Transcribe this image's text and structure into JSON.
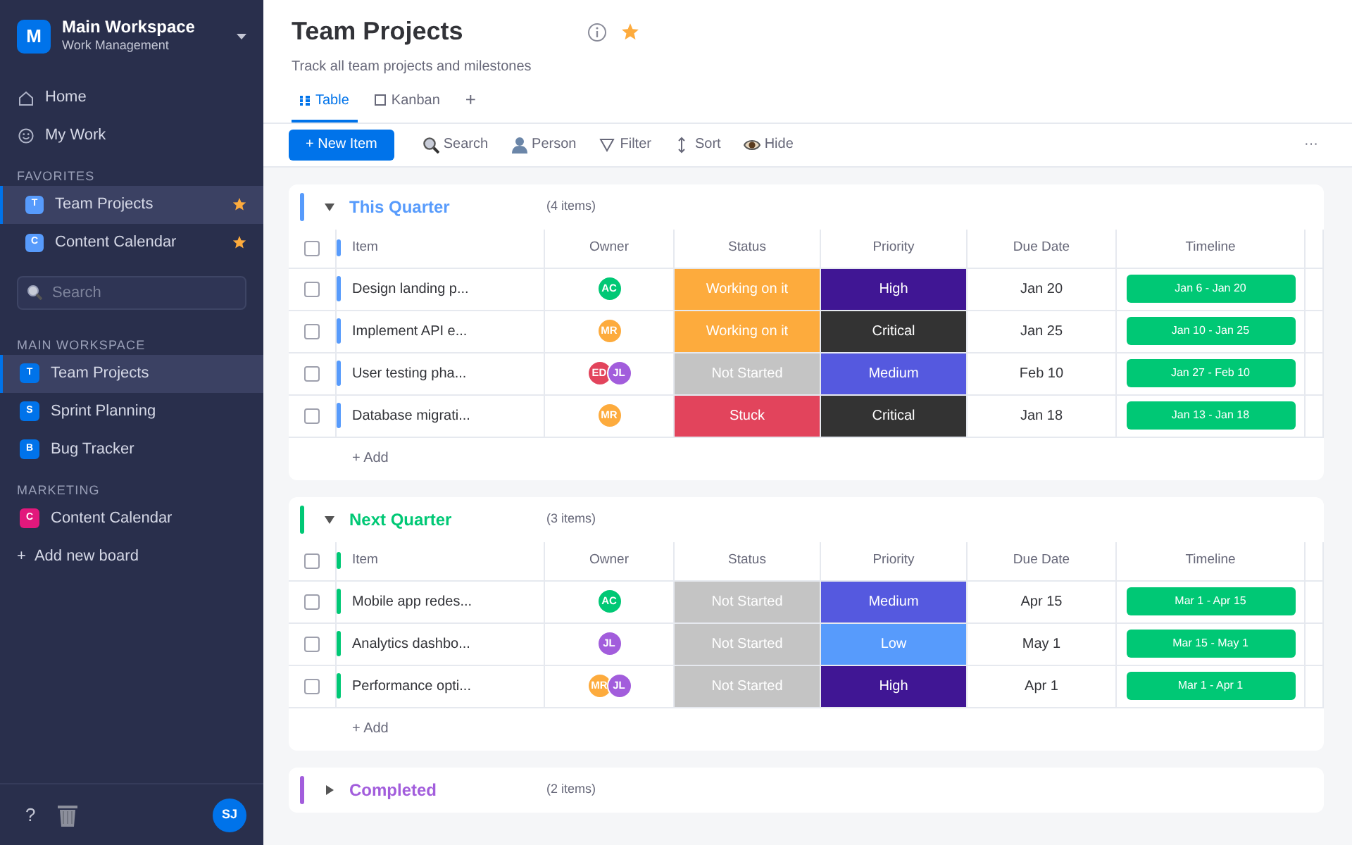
{
  "workspace": {
    "initial": "M",
    "name": "Main Workspace",
    "subtitle": "Work Management"
  },
  "nav": [
    {
      "kind": "home",
      "label": "Home"
    },
    {
      "kind": "mywork",
      "label": "My Work"
    }
  ],
  "favorites": {
    "label": "FAVORITES",
    "items": [
      {
        "initial": "T",
        "label": "Team Projects",
        "color": "#579bfc",
        "selected": true,
        "starred": true
      },
      {
        "initial": "C",
        "label": "Content Calendar",
        "color": "#579bfc",
        "selected": false,
        "starred": true
      }
    ]
  },
  "sidebar_search": {
    "placeholder": "Search"
  },
  "board_sections": [
    {
      "label": "MAIN WORKSPACE",
      "items": [
        {
          "initial": "T",
          "label": "Team Projects",
          "color": "#0073ea",
          "selected": true
        },
        {
          "initial": "S",
          "label": "Sprint Planning",
          "color": "#0073ea",
          "selected": false
        },
        {
          "initial": "B",
          "label": "Bug Tracker",
          "color": "#0073ea",
          "selected": false
        }
      ]
    },
    {
      "label": "MARKETING",
      "items": [
        {
          "initial": "C",
          "label": "Content Calendar",
          "color": "#e2187c",
          "selected": false
        }
      ]
    }
  ],
  "add_board": {
    "icon": "+",
    "label": "Add new board"
  },
  "sidebar_footer": {
    "help": "?",
    "avatar": "SJ"
  },
  "board": {
    "title": "Team Projects",
    "favorite": true,
    "subtitle": "Track all team projects and milestones"
  },
  "tabs": [
    {
      "kind": "table",
      "label": "Table",
      "selected": true
    },
    {
      "kind": "kanban",
      "label": "Kanban",
      "selected": false
    }
  ],
  "add_tab": "+",
  "toolbar": {
    "new_item": "+ New Item",
    "tools": [
      {
        "kind": "search",
        "label": "Search"
      },
      {
        "kind": "person",
        "label": "Person"
      },
      {
        "kind": "filter",
        "label": "Filter"
      },
      {
        "kind": "sort",
        "label": "Sort"
      },
      {
        "kind": "hide",
        "label": "Hide"
      }
    ],
    "more": "···"
  },
  "groups": [
    {
      "title": "This Quarter",
      "color": "#579bfc",
      "count": "(4 items)",
      "expanded": true,
      "all_checked": false,
      "columns": [
        "Item",
        "Owner",
        "Status",
        "Priority",
        "Due Date",
        "Timeline"
      ],
      "rows": [
        {
          "item": "Design landing p...",
          "checked": false,
          "owners": [
            {
              "initials": "AC",
              "color": "#00c875"
            }
          ],
          "status": {
            "label": "Working on it",
            "color": "#fdab3d"
          },
          "priority": {
            "label": "High",
            "color": "#401694"
          },
          "due": "Jan 20",
          "timeline": "Jan 6 - Jan 20"
        },
        {
          "item": "Implement API e...",
          "checked": false,
          "owners": [
            {
              "initials": "MR",
              "color": "#fdab3d"
            }
          ],
          "status": {
            "label": "Working on it",
            "color": "#fdab3d"
          },
          "priority": {
            "label": "Critical",
            "color": "#333333"
          },
          "due": "Jan 25",
          "timeline": "Jan 10 - Jan 25"
        },
        {
          "item": "User testing pha...",
          "checked": false,
          "owners": [
            {
              "initials": "ED",
              "color": "#e2445c"
            },
            {
              "initials": "JL",
              "color": "#a25ddc"
            }
          ],
          "status": {
            "label": "Not Started",
            "color": "#c4c4c4"
          },
          "priority": {
            "label": "Medium",
            "color": "#5559df"
          },
          "due": "Feb 10",
          "timeline": "Jan 27 - Feb 10"
        },
        {
          "item": "Database migrati...",
          "checked": false,
          "owners": [
            {
              "initials": "MR",
              "color": "#fdab3d"
            }
          ],
          "status": {
            "label": "Stuck",
            "color": "#e2445c"
          },
          "priority": {
            "label": "Critical",
            "color": "#333333"
          },
          "due": "Jan 18",
          "timeline": "Jan 13 - Jan 18"
        }
      ],
      "add": "+ Add"
    },
    {
      "title": "Next Quarter",
      "color": "#00c875",
      "count": "(3 items)",
      "expanded": true,
      "all_checked": false,
      "columns": [
        "Item",
        "Owner",
        "Status",
        "Priority",
        "Due Date",
        "Timeline"
      ],
      "rows": [
        {
          "item": "Mobile app redes...",
          "checked": false,
          "owners": [
            {
              "initials": "AC",
              "color": "#00c875"
            }
          ],
          "status": {
            "label": "Not Started",
            "color": "#c4c4c4"
          },
          "priority": {
            "label": "Medium",
            "color": "#5559df"
          },
          "due": "Apr 15",
          "timeline": "Mar 1 - Apr 15"
        },
        {
          "item": "Analytics dashbo...",
          "checked": false,
          "owners": [
            {
              "initials": "JL",
              "color": "#a25ddc"
            }
          ],
          "status": {
            "label": "Not Started",
            "color": "#c4c4c4"
          },
          "priority": {
            "label": "Low",
            "color": "#579bfc"
          },
          "due": "May 1",
          "timeline": "Mar 15 - May 1"
        },
        {
          "item": "Performance opti...",
          "checked": false,
          "owners": [
            {
              "initials": "MR",
              "color": "#fdab3d"
            },
            {
              "initials": "JL",
              "color": "#a25ddc"
            }
          ],
          "status": {
            "label": "Not Started",
            "color": "#c4c4c4"
          },
          "priority": {
            "label": "High",
            "color": "#401694"
          },
          "due": "Apr 1",
          "timeline": "Mar 1 - Apr 1"
        }
      ],
      "add": "+ Add"
    },
    {
      "title": "Completed",
      "color": "#a25ddc",
      "count": "(2 items)",
      "expanded": false
    }
  ]
}
